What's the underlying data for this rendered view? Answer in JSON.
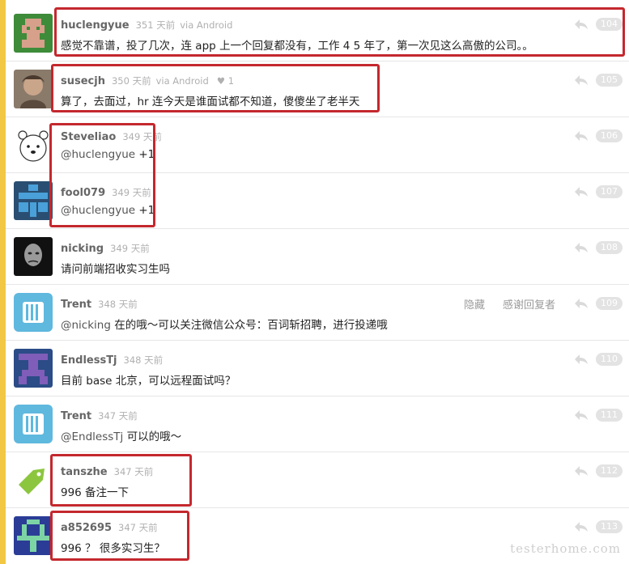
{
  "replies": [
    {
      "author": "huclengyue",
      "time": "351 天前",
      "via": "via Android",
      "content": "感觉不靠谱，投了几次，连 app 上一个回复都没有，工作 4 5 年了，第一次见这么高傲的公司。。",
      "floor": "104"
    },
    {
      "author": "susecjh",
      "time": "350 天前",
      "via": "via Android",
      "likes": "1",
      "content": "算了，去面过，hr 连今天是谁面试都不知道，傻傻坐了老半天",
      "floor": "105"
    },
    {
      "author": "Steveliao",
      "time": "349 天前",
      "mention": "@huclengyue",
      "content": "+1",
      "floor": "106"
    },
    {
      "author": "fool079",
      "time": "349 天前",
      "mention": "@huclengyue",
      "content": "+1",
      "floor": "107"
    },
    {
      "author": "nicking",
      "time": "349 天前",
      "content": "请问前端招收实习生吗",
      "floor": "108"
    },
    {
      "author": "Trent",
      "time": "348 天前",
      "mention": "@nicking",
      "content": "在的哦～可以关注微信公众号：百词斩招聘，进行投递哦",
      "floor": "109",
      "hide_label": "隐藏",
      "thank_label": "感谢回复者"
    },
    {
      "author": "EndlessTj",
      "time": "348 天前",
      "content": "目前 base 北京，可以远程面试吗？",
      "floor": "110"
    },
    {
      "author": "Trent",
      "time": "347 天前",
      "mention": "@EndlessTj",
      "content": "可以的哦～",
      "floor": "111"
    },
    {
      "author": "tanszhe",
      "time": "347 天前",
      "content": "996 备注一下",
      "floor": "112"
    },
    {
      "author": "a852695",
      "time": "347 天前",
      "content": "996 ？ 很多实习生？",
      "floor": "113"
    }
  ],
  "watermark": "testerhome.com",
  "colors": {
    "highlight": "#c4282e",
    "left_stripe": "#f2c744",
    "floor_badge": "#e3e3e3"
  }
}
